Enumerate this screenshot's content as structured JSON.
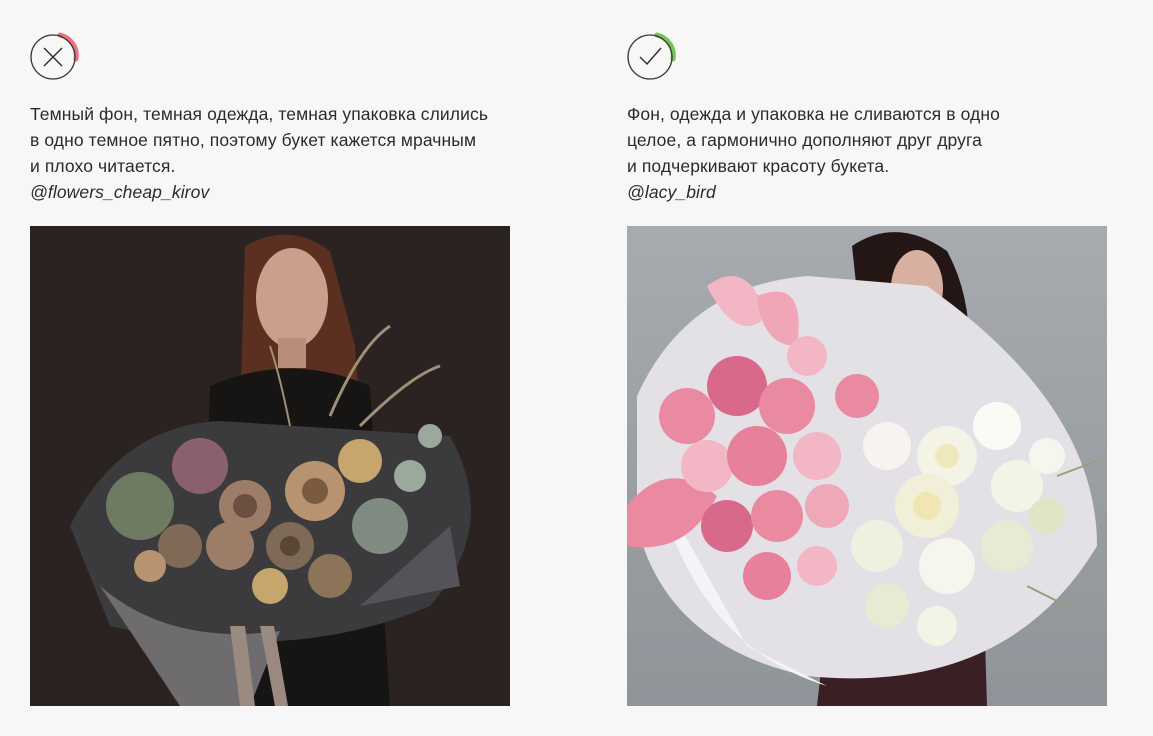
{
  "examples": [
    {
      "verdict_icon": "cross-icon",
      "accent_color": "#e9747f",
      "caption_lines": [
        "Темный фон, темная одежда, темная упаковка слились",
        "в одно темное пятно, поэтому букет кажется мрачным",
        "и плохо читается."
      ],
      "handle": "@flowers_cheap_kirov",
      "photo_colors": {
        "background": "#2a2321",
        "clothing": "#171414",
        "wrap": "#3b3a3d",
        "wrap_light": "#6f6c6f",
        "flowers": [
          "#9c7e68",
          "#7f6a58",
          "#6e7a61",
          "#c7a66e",
          "#8a6070",
          "#b8936f"
        ]
      }
    },
    {
      "verdict_icon": "check-icon",
      "accent_color": "#76c653",
      "caption_lines": [
        "Фон, одежда и упаковка не сливаются в одно",
        "целое, а гармонично дополняют друг друга",
        "и подчеркивают красоту букета."
      ],
      "handle": "@lacy_bird",
      "photo_colors": {
        "background": "#a6a9ad",
        "clothing": "#3a1f24",
        "wrap": "#e4e1e6",
        "wrap_light": "#f5f3f6",
        "flowers": [
          "#e98aa1",
          "#f3b6c4",
          "#d9698a",
          "#fbe9ea",
          "#f3f4e6",
          "#e8ebd3"
        ]
      }
    }
  ]
}
